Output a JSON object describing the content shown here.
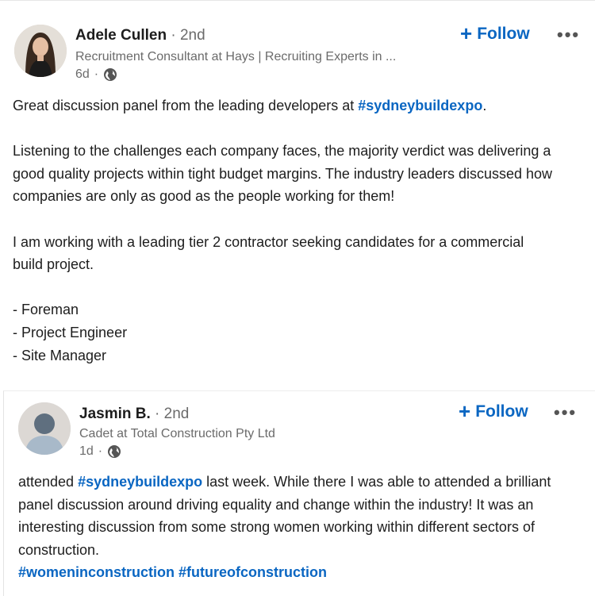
{
  "posts": [
    {
      "author": "Adele Cullen",
      "degree": "2nd",
      "headline": "Recruitment Consultant at Hays | Recruiting Experts in ...",
      "age": "6d",
      "follow_label": "Follow",
      "more_label": "•••",
      "body": {
        "p1_pre": "Great discussion panel from the leading developers at ",
        "p1_tag": "#sydneybuildexpo",
        "p1_post": ".",
        "p2": "Listening to the challenges each company faces, the majority verdict was delivering a good quality projects within tight budget margins. The industry leaders discussed how companies are only as good as the people working for them!",
        "p3": "I am working with a leading tier 2 contractor seeking candidates for a commercial build project.",
        "list": [
          "- Foreman",
          "- Project Engineer",
          "- Site Manager"
        ]
      }
    },
    {
      "author": "Jasmin B.",
      "degree": "2nd",
      "headline": "Cadet at Total Construction Pty Ltd",
      "age": "1d",
      "follow_label": "Follow",
      "more_label": "•••",
      "body": {
        "pre": "attended ",
        "tag1": "#sydneybuildexpo",
        "post": " last week. While there I was able to attended a brilliant panel discussion around driving equality and change within the industry! It was an interesting discussion from some strong women working within different sectors of construction.",
        "tag2": "#womeninconstruction",
        "tag3": "#futureofconstruction"
      }
    }
  ],
  "icons": {
    "visibility": "globe-icon",
    "follow": "plus-icon",
    "menu": "more-icon"
  },
  "colors": {
    "link": "#0a66c2",
    "muted": "#6b6b6b",
    "text": "#1d1d1d"
  }
}
